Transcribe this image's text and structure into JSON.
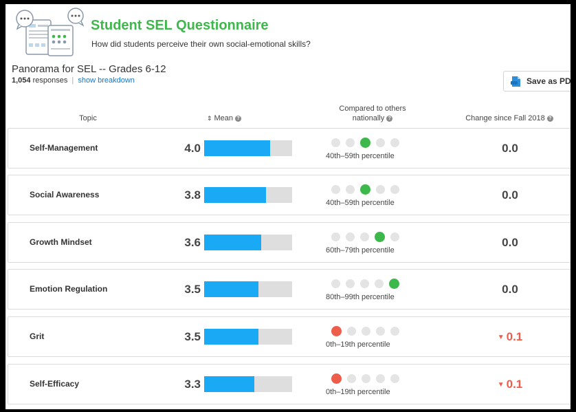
{
  "header": {
    "title": "Student SEL Questionnaire",
    "subtitle": "How did students perceive their own social-emotional skills?"
  },
  "survey": {
    "name": "Panorama for SEL -- Grades 6-12",
    "response_count": "1,054",
    "response_label": "responses",
    "separator": "|",
    "breakdown_link": "show breakdown"
  },
  "toolbar": {
    "save_label": "Save as PD"
  },
  "table": {
    "headers": {
      "topic": "Topic",
      "mean_sort": "⇕",
      "mean": "Mean",
      "compare_line1": "Compared to others",
      "compare_line2": "nationally",
      "change": "Change since Fall 2018",
      "help": "?"
    },
    "rows": [
      {
        "topic": "Self-Management",
        "mean": "4.0",
        "mean_fill": 0.75,
        "active_dot": 3,
        "percentile": "40th–59th percentile",
        "change": "0.0",
        "direction": "none"
      },
      {
        "topic": "Social Awareness",
        "mean": "3.8",
        "mean_fill": 0.7,
        "active_dot": 3,
        "percentile": "40th–59th percentile",
        "change": "0.0",
        "direction": "none"
      },
      {
        "topic": "Growth Mindset",
        "mean": "3.6",
        "mean_fill": 0.65,
        "active_dot": 4,
        "percentile": "60th–79th percentile",
        "change": "0.0",
        "direction": "none"
      },
      {
        "topic": "Emotion Regulation",
        "mean": "3.5",
        "mean_fill": 0.62,
        "active_dot": 5,
        "percentile": "80th–99th percentile",
        "change": "0.0",
        "direction": "none"
      },
      {
        "topic": "Grit",
        "mean": "3.5",
        "mean_fill": 0.62,
        "active_dot": 1,
        "percentile": "0th–19th percentile",
        "change": "0.1",
        "direction": "down"
      },
      {
        "topic": "Self-Efficacy",
        "mean": "3.3",
        "mean_fill": 0.57,
        "active_dot": 1,
        "percentile": "0th–19th percentile",
        "change": "0.1",
        "direction": "down"
      }
    ]
  },
  "colors": {
    "accent_green": "#3db84a",
    "bar_blue": "#19a9f5",
    "bar_track": "#dedede",
    "dot_inactive": "#e4e4e4",
    "decline_red": "#ee5c4a",
    "link_blue": "#1a75c0"
  },
  "icons": {
    "logo": "questionnaire-illustration-icon",
    "save": "pdf-file-icon",
    "help": "help-circle-icon",
    "sort": "sort-icon",
    "change_down": "triangle-down-icon"
  }
}
